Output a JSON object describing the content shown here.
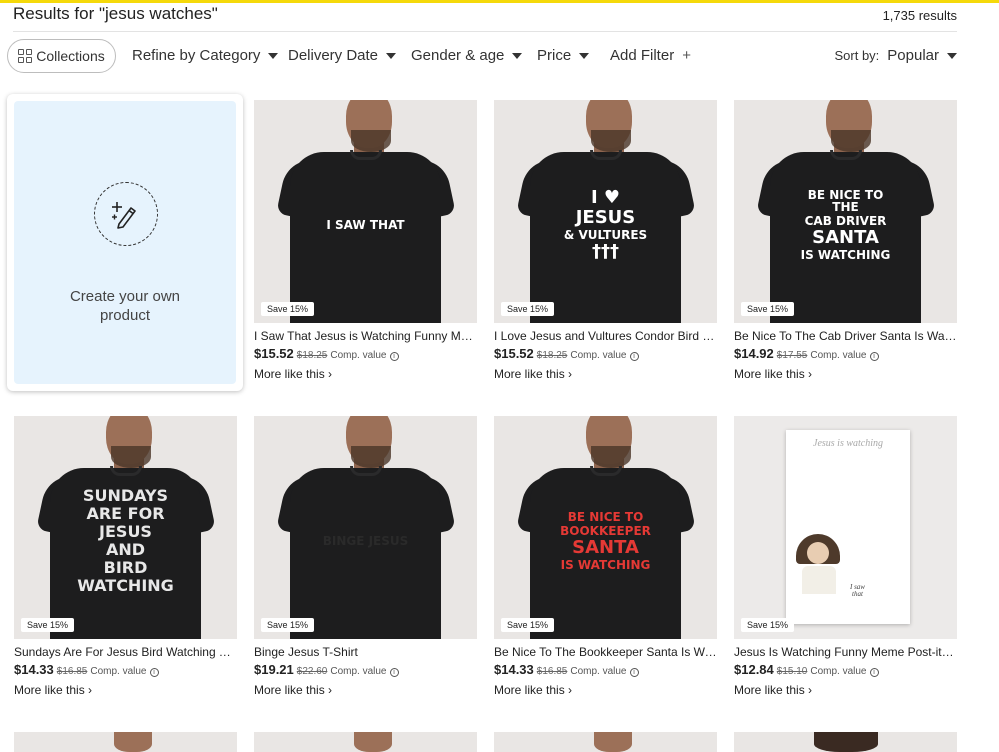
{
  "search": {
    "title": "Results for \"jesus watches\"",
    "count": "1,735 results"
  },
  "filters": {
    "collections": "Collections",
    "items": [
      {
        "label": "Refine by Category"
      },
      {
        "label": "Delivery Date"
      },
      {
        "label": "Gender & age"
      },
      {
        "label": "Price"
      }
    ],
    "add_filter": "Add Filter",
    "add_symbol": "+",
    "sort_label": "Sort by:",
    "sort_value": "Popular"
  },
  "create": {
    "label_line1": "Create your own",
    "label_line2": "product"
  },
  "common": {
    "save_badge": "Save 15%",
    "comp_value": "Comp. value",
    "more_like": "More like this",
    "info_glyph": "i",
    "chevron": "›"
  },
  "products": [
    {
      "title": "I Saw That Jesus is Watching Funny Meme T-Shirt",
      "price": "$15.52",
      "old_price": "$18.25",
      "print_lines": [
        "I SAW THAT"
      ],
      "print_color": "#ffffff"
    },
    {
      "title": "I Love Jesus and Vultures Condor Bird Watching T-Shirt",
      "price": "$15.52",
      "old_price": "$18.25",
      "print_lines": [
        "I ♥",
        "JESUS",
        "& VULTURES",
        "†††"
      ],
      "print_color": "#ffffff"
    },
    {
      "title": "Be Nice To The Cab Driver Santa Is Watching T-Shirt",
      "price": "$14.92",
      "old_price": "$17.55",
      "print_lines": [
        "BE NICE TO THE",
        "CAB DRIVER",
        "SANTA",
        "IS WATCHING"
      ],
      "print_color": "#ffffff"
    },
    {
      "title": "Sundays Are For Jesus Bird Watching T-Shirt",
      "price": "$14.33",
      "old_price": "$16.85",
      "print_lines": [
        "SUNDAYS",
        "ARE FOR",
        "JESUS",
        "AND",
        "BIRD",
        "WATCHING"
      ],
      "print_color": "#e8e8e8"
    },
    {
      "title": "Binge Jesus T-Shirt",
      "price": "$19.21",
      "old_price": "$22.60",
      "print_lines": [
        "BINGE JESUS"
      ],
      "print_color": "#2a2a2a"
    },
    {
      "title": "Be Nice To The Bookkeeper Santa Is Watching T-Shirt",
      "price": "$14.33",
      "old_price": "$16.85",
      "print_lines": [
        "BE NICE TO",
        "BOOKKEEPER",
        "SANTA",
        "IS WATCHING"
      ],
      "print_color": "#e53935"
    },
    {
      "title": "Jesus Is Watching Funny Meme Post-it® Notes",
      "price": "$12.84",
      "old_price": "$15.10",
      "note_title": "Jesus is watching",
      "note_caption_1": "I saw",
      "note_caption_2": "that"
    }
  ],
  "colors": {
    "accent_bar": "#f5d90a",
    "create_bg": "#e6f3fd"
  }
}
